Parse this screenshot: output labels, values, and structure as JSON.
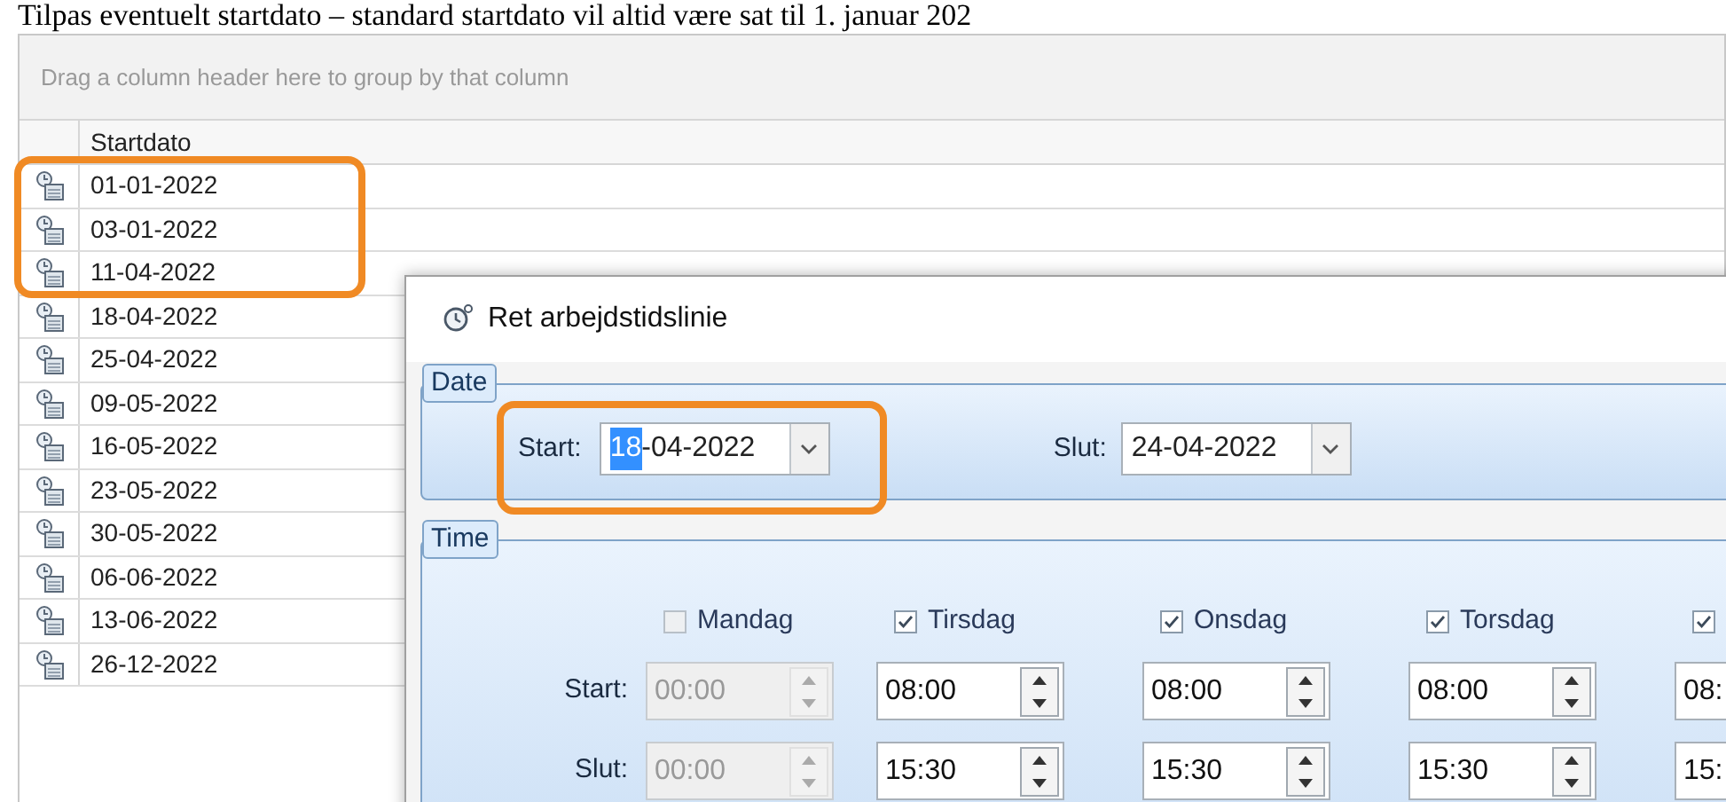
{
  "caption": "Tilpas eventuelt startdato – standard startdato vil altid være sat til 1. januar 202",
  "grid": {
    "group_hint": "Drag a column header here to group by that column",
    "columns": [
      "Startdato"
    ],
    "rows": [
      "01-01-2022",
      "03-01-2022",
      "11-04-2022",
      "18-04-2022",
      "25-04-2022",
      "09-05-2022",
      "16-05-2022",
      "23-05-2022",
      "30-05-2022",
      "06-06-2022",
      "13-06-2022",
      "26-12-2022"
    ]
  },
  "dialog": {
    "title": "Ret arbejdstidslinie",
    "date_group": {
      "legend": "Date",
      "start_label": "Start:",
      "start_selected": "18",
      "start_rest": "-04-2022",
      "end_label": "Slut:",
      "end_value": "24-04-2022"
    },
    "time_group": {
      "legend": "Time",
      "start_label": "Start:",
      "end_label": "Slut:",
      "days": [
        {
          "label": "Mandag",
          "checked": false,
          "start": "00:00",
          "end": "00:00"
        },
        {
          "label": "Tirsdag",
          "checked": true,
          "start": "08:00",
          "end": "15:30"
        },
        {
          "label": "Onsdag",
          "checked": true,
          "start": "08:00",
          "end": "15:30"
        },
        {
          "label": "Torsdag",
          "checked": true,
          "start": "08:00",
          "end": "15:30"
        },
        {
          "checked": true,
          "start": "08:",
          "end": "15:"
        }
      ]
    }
  }
}
